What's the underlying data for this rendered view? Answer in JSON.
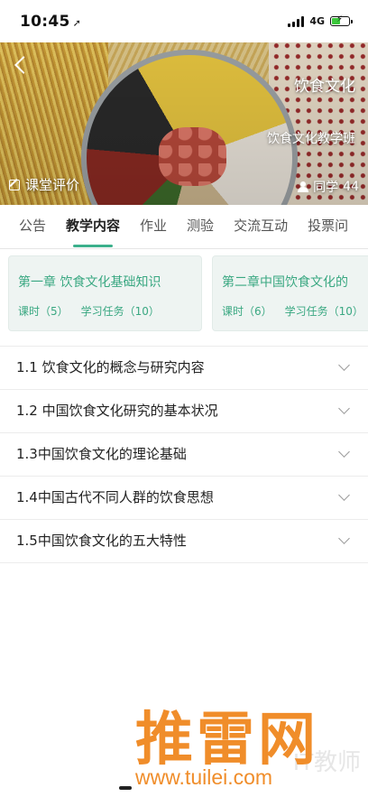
{
  "status_bar": {
    "time": "10:45",
    "network": "4G",
    "battery_level": 0.55
  },
  "header": {
    "course_title": "饮食文化",
    "class_name": "饮食文化教学班",
    "evaluate_label": "课堂评价",
    "classmates_label": "同学",
    "classmates_count": "44"
  },
  "tabs": [
    {
      "label": "公告",
      "active": false
    },
    {
      "label": "教学内容",
      "active": true
    },
    {
      "label": "作业",
      "active": false
    },
    {
      "label": "测验",
      "active": false
    },
    {
      "label": "交流互动",
      "active": false
    },
    {
      "label": "投票问",
      "active": false
    }
  ],
  "chapters": [
    {
      "title": "第一章 饮食文化基础知识",
      "lessons": "课时（5）",
      "tasks": "学习任务（10）"
    },
    {
      "title": "第二章中国饮食文化的",
      "lessons": "课时（6）",
      "tasks": "学习任务（10）"
    }
  ],
  "sections": [
    {
      "label": "1.1 饮食文化的概念与研究内容"
    },
    {
      "label": "1.2 中国饮食文化研究的基本状况"
    },
    {
      "label": "1.3中国饮食文化的理论基础"
    },
    {
      "label": "1.4中国古代不同人群的饮食思想"
    },
    {
      "label": "1.5中国饮食文化的五大特性"
    }
  ],
  "watermark": {
    "brand": "推雷网",
    "url": "www.tuilei.com",
    "ghost": "IT教师"
  },
  "colors": {
    "accent": "#3cb08c",
    "card_text": "#3aa882",
    "watermark": "#f08d2a"
  }
}
